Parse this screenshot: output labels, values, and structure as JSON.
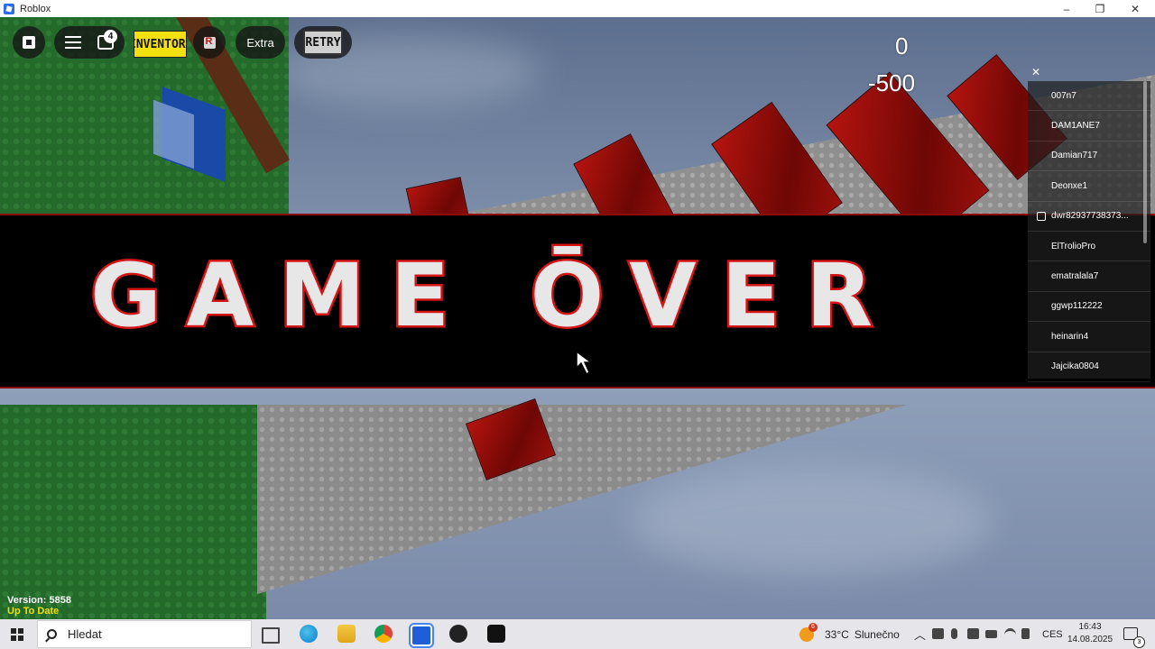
{
  "window": {
    "title": "Roblox",
    "controls": {
      "minimize": "–",
      "maximize": "❐",
      "close": "✕"
    }
  },
  "toolbar": {
    "chat_badge": "4",
    "inventory_label": "INVENTOR",
    "extra_label": "Extra",
    "retry_label": "RETRY"
  },
  "score": {
    "value": "0",
    "change": "-500"
  },
  "banner": {
    "text": "GAME ŌVER"
  },
  "player_list": {
    "close_label": "✕",
    "players": [
      {
        "name": "007n7",
        "verified": false
      },
      {
        "name": "DAM1ANE7",
        "verified": false
      },
      {
        "name": "Damian717",
        "verified": false
      },
      {
        "name": "Deonxe1",
        "verified": false
      },
      {
        "name": "dwr82937738373...",
        "verified": true
      },
      {
        "name": "ElTrolioPro",
        "verified": false
      },
      {
        "name": "ematralala7",
        "verified": false
      },
      {
        "name": "ggwp112222",
        "verified": false
      },
      {
        "name": "heinarin4",
        "verified": false
      },
      {
        "name": "Jajcika0804",
        "verified": false
      }
    ]
  },
  "version": {
    "line1": "Version: 5858",
    "line2": "Up To Date"
  },
  "taskbar": {
    "search_placeholder": "Hledat",
    "weather": {
      "badge": "6",
      "temp": "33°C",
      "condition": "Slunečno"
    },
    "language": "CES",
    "time": "16:43",
    "date": "14.08.2025",
    "notification_count": "3"
  },
  "colors": {
    "banner_text": "#e7e7e7",
    "banner_stroke": "#d41515",
    "inventory_bg": "#f2e10f",
    "version_status": "#f2e10f"
  },
  "icons": [
    "roblox-logo-icon",
    "hamburger-menu-icon",
    "chat-icon",
    "roblox-r-icon",
    "windows-start-icon",
    "search-icon",
    "task-view-icon",
    "edge-icon",
    "file-explorer-icon",
    "chrome-icon",
    "roblox-taskbar-icon",
    "obs-icon",
    "epic-games-icon",
    "weather-icon",
    "notification-icon"
  ]
}
